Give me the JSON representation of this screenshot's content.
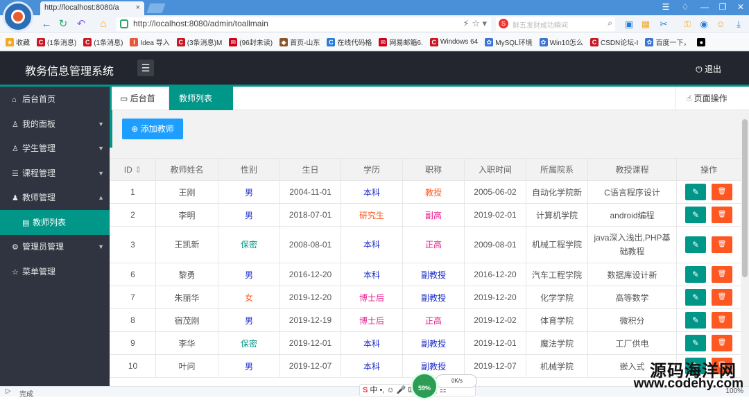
{
  "browser": {
    "tab_title": "http://localhost:8080/a",
    "url": "http://localhost:8080/admin/toallmain",
    "search_placeholder": "鲜五发财成功瞬间",
    "bookmarks": [
      {
        "label": "收藏",
        "color": "#f5a623",
        "icon": "★"
      },
      {
        "label": "(1条消息)",
        "color": "#c81623",
        "icon": "C"
      },
      {
        "label": "(1条消息)",
        "color": "#c81623",
        "icon": "C"
      },
      {
        "label": "Idea 导入",
        "color": "#e25a3c",
        "icon": "I"
      },
      {
        "label": "(3条消息)M",
        "color": "#c81623",
        "icon": "C"
      },
      {
        "label": "(96封未读)",
        "color": "#d0021b",
        "icon": "✉"
      },
      {
        "label": "首页-山东",
        "color": "#8b572a",
        "icon": "◆"
      },
      {
        "label": "在线代码格",
        "color": "#2a7bd6",
        "icon": "C"
      },
      {
        "label": "网易邮箱6.",
        "color": "#d0021b",
        "icon": "✉"
      },
      {
        "label": "Windows 64",
        "color": "#c81623",
        "icon": "C"
      },
      {
        "label": "MySQL环境",
        "color": "#3b73d6",
        "icon": "✿"
      },
      {
        "label": "Win10怎么",
        "color": "#3b73d6",
        "icon": "✿"
      },
      {
        "label": "CSDN论坛-I",
        "color": "#c81623",
        "icon": "C"
      },
      {
        "label": "百度一下，",
        "color": "#3b73d6",
        "icon": "✿"
      },
      {
        "label": "",
        "color": "#000000",
        "icon": "●"
      }
    ],
    "status_text": "完成",
    "zoom": "100%",
    "speed_percent": "59%",
    "speed_rate": "0K/s"
  },
  "app": {
    "title": "教务信息管理系统",
    "logout": "退出",
    "accent": "#009688"
  },
  "sidebar": {
    "items": [
      {
        "label": "后台首页",
        "icon": "⌂",
        "arrow": ""
      },
      {
        "label": "我的面板",
        "icon": "♙",
        "arrow": "▼"
      },
      {
        "label": "学生管理",
        "icon": "♙",
        "arrow": "▼"
      },
      {
        "label": "课程管理",
        "icon": "☰",
        "arrow": "▼"
      },
      {
        "label": "教师管理",
        "icon": "♟",
        "arrow": "▲"
      },
      {
        "label": "教师列表",
        "icon": "▤",
        "arrow": ""
      },
      {
        "label": "管理员管理",
        "icon": "⚙",
        "arrow": "▼"
      },
      {
        "label": "菜单管理",
        "icon": "☆",
        "arrow": ""
      }
    ]
  },
  "page_tabs": {
    "home": "后台首页",
    "active": "教师列表",
    "page_ops": "页面操作"
  },
  "toolbar": {
    "add_label": "添加教师"
  },
  "table": {
    "headers": [
      "ID",
      "教师姓名",
      "性别",
      "生日",
      "学历",
      "职称",
      "入职时间",
      "所属院系",
      "教授课程",
      "操作"
    ],
    "rows": [
      {
        "id": "1",
        "name": "王刚",
        "gender": "男",
        "birth": "2004-11-01",
        "edu": "本科",
        "title": "教授",
        "join": "2005-06-02",
        "dept": "自动化学院新",
        "course": "C语言程序设计"
      },
      {
        "id": "2",
        "name": "李明",
        "gender": "男",
        "birth": "2018-07-01",
        "edu": "研究生",
        "title": "副高",
        "join": "2019-02-01",
        "dept": "计算机学院",
        "course": "android编程"
      },
      {
        "id": "3",
        "name": "王凯新",
        "gender": "保密",
        "birth": "2008-08-01",
        "edu": "本科",
        "title": "正高",
        "join": "2009-08-01",
        "dept": "机械工程学院",
        "course": "java深入浅出,PHP基础教程"
      },
      {
        "id": "6",
        "name": "黎勇",
        "gender": "男",
        "birth": "2016-12-20",
        "edu": "本科",
        "title": "副教授",
        "join": "2016-12-20",
        "dept": "汽车工程学院",
        "course": "数据库设计新"
      },
      {
        "id": "7",
        "name": "朱丽华",
        "gender": "女",
        "birth": "2019-12-20",
        "edu": "博士后",
        "title": "副教授",
        "join": "2019-12-20",
        "dept": "化学学院",
        "course": "高等数学"
      },
      {
        "id": "8",
        "name": "宿茂刚",
        "gender": "男",
        "birth": "2019-12-19",
        "edu": "博士后",
        "title": "正高",
        "join": "2019-12-02",
        "dept": "体育学院",
        "course": "微积分"
      },
      {
        "id": "9",
        "name": "李华",
        "gender": "保密",
        "birth": "2019-12-01",
        "edu": "本科",
        "title": "副教授",
        "join": "2019-12-01",
        "dept": "魔法学院",
        "course": "工厂供电"
      },
      {
        "id": "10",
        "name": "叶问",
        "gender": "男",
        "birth": "2019-12-07",
        "edu": "本科",
        "title": "副教授",
        "join": "2019-12-07",
        "dept": "机械学院",
        "course": "嵌入式"
      }
    ]
  },
  "watermark": {
    "line1": "源码海洋网",
    "line2": "www.codehy.com"
  }
}
